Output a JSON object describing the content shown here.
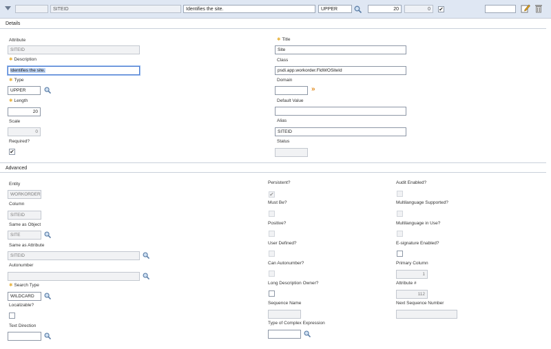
{
  "topbar": {
    "field_code": "SITEID",
    "field_description": "Identifies the site.",
    "field_type": "UPPER",
    "field_length": "20",
    "field_scale": "0"
  },
  "details": {
    "section_title": "Details",
    "attribute_label": "Attribute",
    "attribute_value": "SITEID",
    "description_label": "Description",
    "description_value": "Identifies the site.",
    "type_label": "Type",
    "type_value": "UPPER",
    "length_label": "Length",
    "length_value": "20",
    "scale_label": "Scale",
    "scale_value": "0",
    "required_label": "Required?",
    "title_label": "Title",
    "title_value": "Site",
    "class_label": "Class",
    "class_value": "psdi.app.workorder.FldWOSiteId",
    "domain_label": "Domain",
    "domain_value": "",
    "default_label": "Default Value",
    "default_value": "",
    "alias_label": "Alias",
    "alias_value": "SITEID",
    "status_label": "Status",
    "status_value": ""
  },
  "advanced": {
    "section_title": "Advanced",
    "entity_label": "Entity",
    "entity_value": "WORKORDER",
    "column_label": "Column",
    "column_value": "SITEID",
    "same_obj_label": "Same as Object",
    "same_obj_value": "SITE",
    "same_attr_label": "Same as Attribute",
    "same_attr_value": "SITEID",
    "autonumber_label": "Autonumber",
    "autonumber_value": "",
    "search_type_label": "Search Type",
    "search_type_value": "WILDCARD",
    "localizable_label": "Localizable?",
    "text_dir_label": "Text Direction",
    "text_dir_value": "",
    "persistent_label": "Persistent?",
    "must_be_label": "Must Be?",
    "positive_label": "Positive?",
    "user_defined_label": "User Defined?",
    "can_autonumber_label": "Can Autonumber?",
    "long_desc_label": "Long Description Owner?",
    "seq_name_label": "Sequence Name",
    "seq_name_value": "",
    "complex_expr_label": "Type of Complex Expression",
    "complex_expr_value": "",
    "audit_label": "Audit Enabled?",
    "multilang_sup_label": "Multilanguage Supported?",
    "multilang_use_label": "Multilanguage in Use?",
    "esig_label": "E-signature Enabled?",
    "primary_col_label": "Primary Column",
    "primary_col_value": "1",
    "attr_num_label": "Attribute #",
    "attr_num_value": "112",
    "next_seq_label": "Next Sequence Number",
    "next_seq_value": ""
  },
  "checks": {
    "required": "✔",
    "persistent": "✔",
    "topbar": "✔"
  }
}
